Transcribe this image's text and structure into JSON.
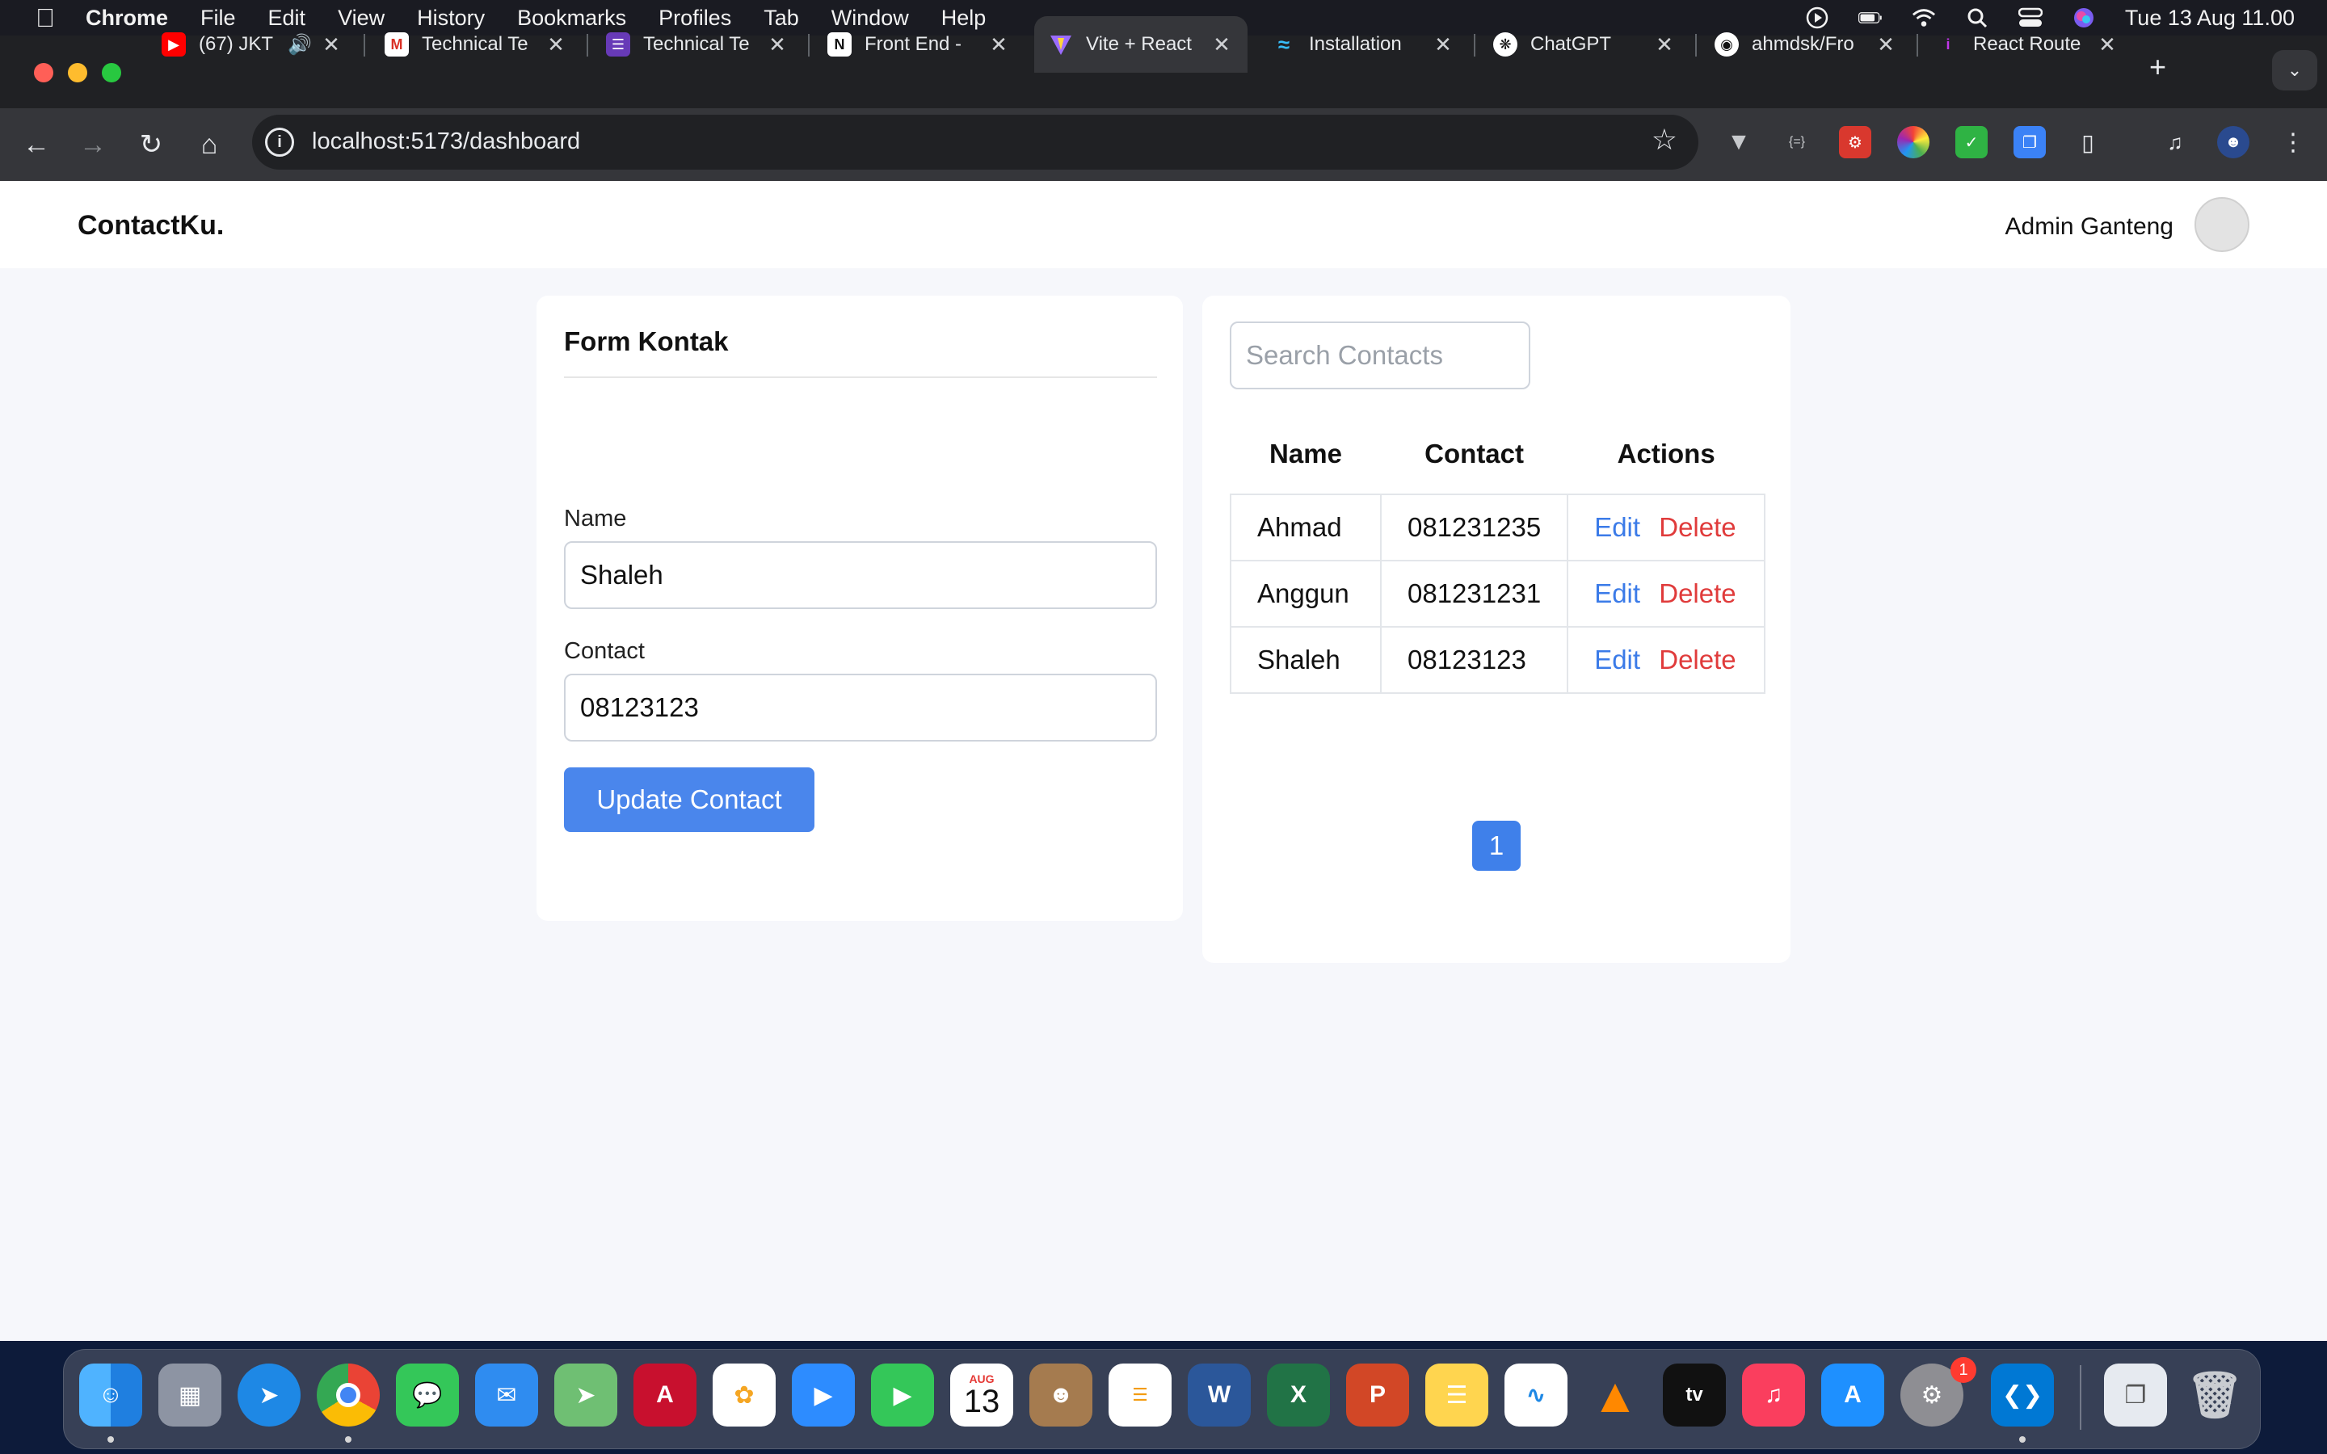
{
  "menubar": {
    "app": "Chrome",
    "items": [
      "File",
      "Edit",
      "View",
      "History",
      "Bookmarks",
      "Profiles",
      "Tab",
      "Window",
      "Help"
    ],
    "clock": "Tue 13 Aug  11.00"
  },
  "tabs": [
    {
      "title": "(67) JKT",
      "favicon": "youtube-icon"
    },
    {
      "title": "Technical Te",
      "favicon": "gmail-icon"
    },
    {
      "title": "Technical Te",
      "favicon": "forms-icon"
    },
    {
      "title": "Front End -",
      "favicon": "notion-icon"
    },
    {
      "title": "Vite + React",
      "favicon": "vite-icon"
    },
    {
      "title": "Installation",
      "favicon": "tailwind-icon"
    },
    {
      "title": "ChatGPT",
      "favicon": "chatgpt-icon"
    },
    {
      "title": "ahmdsk/Fro",
      "favicon": "github-icon"
    },
    {
      "title": "React Route",
      "favicon": "react-router-icon"
    }
  ],
  "toolbar": {
    "url": "localhost:5173/dashboard"
  },
  "navbar": {
    "brand": "ContactKu.",
    "user": "Admin Ganteng"
  },
  "form": {
    "title": "Form Kontak",
    "name_label": "Name",
    "name_value": "Shaleh",
    "contact_label": "Contact",
    "contact_value": "08123123",
    "submit_label": "Update Contact"
  },
  "list": {
    "search_placeholder": "Search Contacts",
    "columns": [
      "Name",
      "Contact",
      "Actions"
    ],
    "rows": [
      {
        "name": "Ahmad",
        "contact": "081231235",
        "edit": "Edit",
        "delete": "Delete"
      },
      {
        "name": "Anggun",
        "contact": "081231231",
        "edit": "Edit",
        "delete": "Delete"
      },
      {
        "name": "Shaleh",
        "contact": "08123123",
        "edit": "Edit",
        "delete": "Delete"
      }
    ],
    "current_page": "1"
  },
  "dock": {
    "calendar_month": "AUG",
    "calendar_day": "13",
    "settings_badge": "1"
  },
  "colors": {
    "primary": "#4a86ec",
    "edit": "#3b7be8",
    "delete": "#e03b3b",
    "page_bg": "#f6f7fb"
  }
}
